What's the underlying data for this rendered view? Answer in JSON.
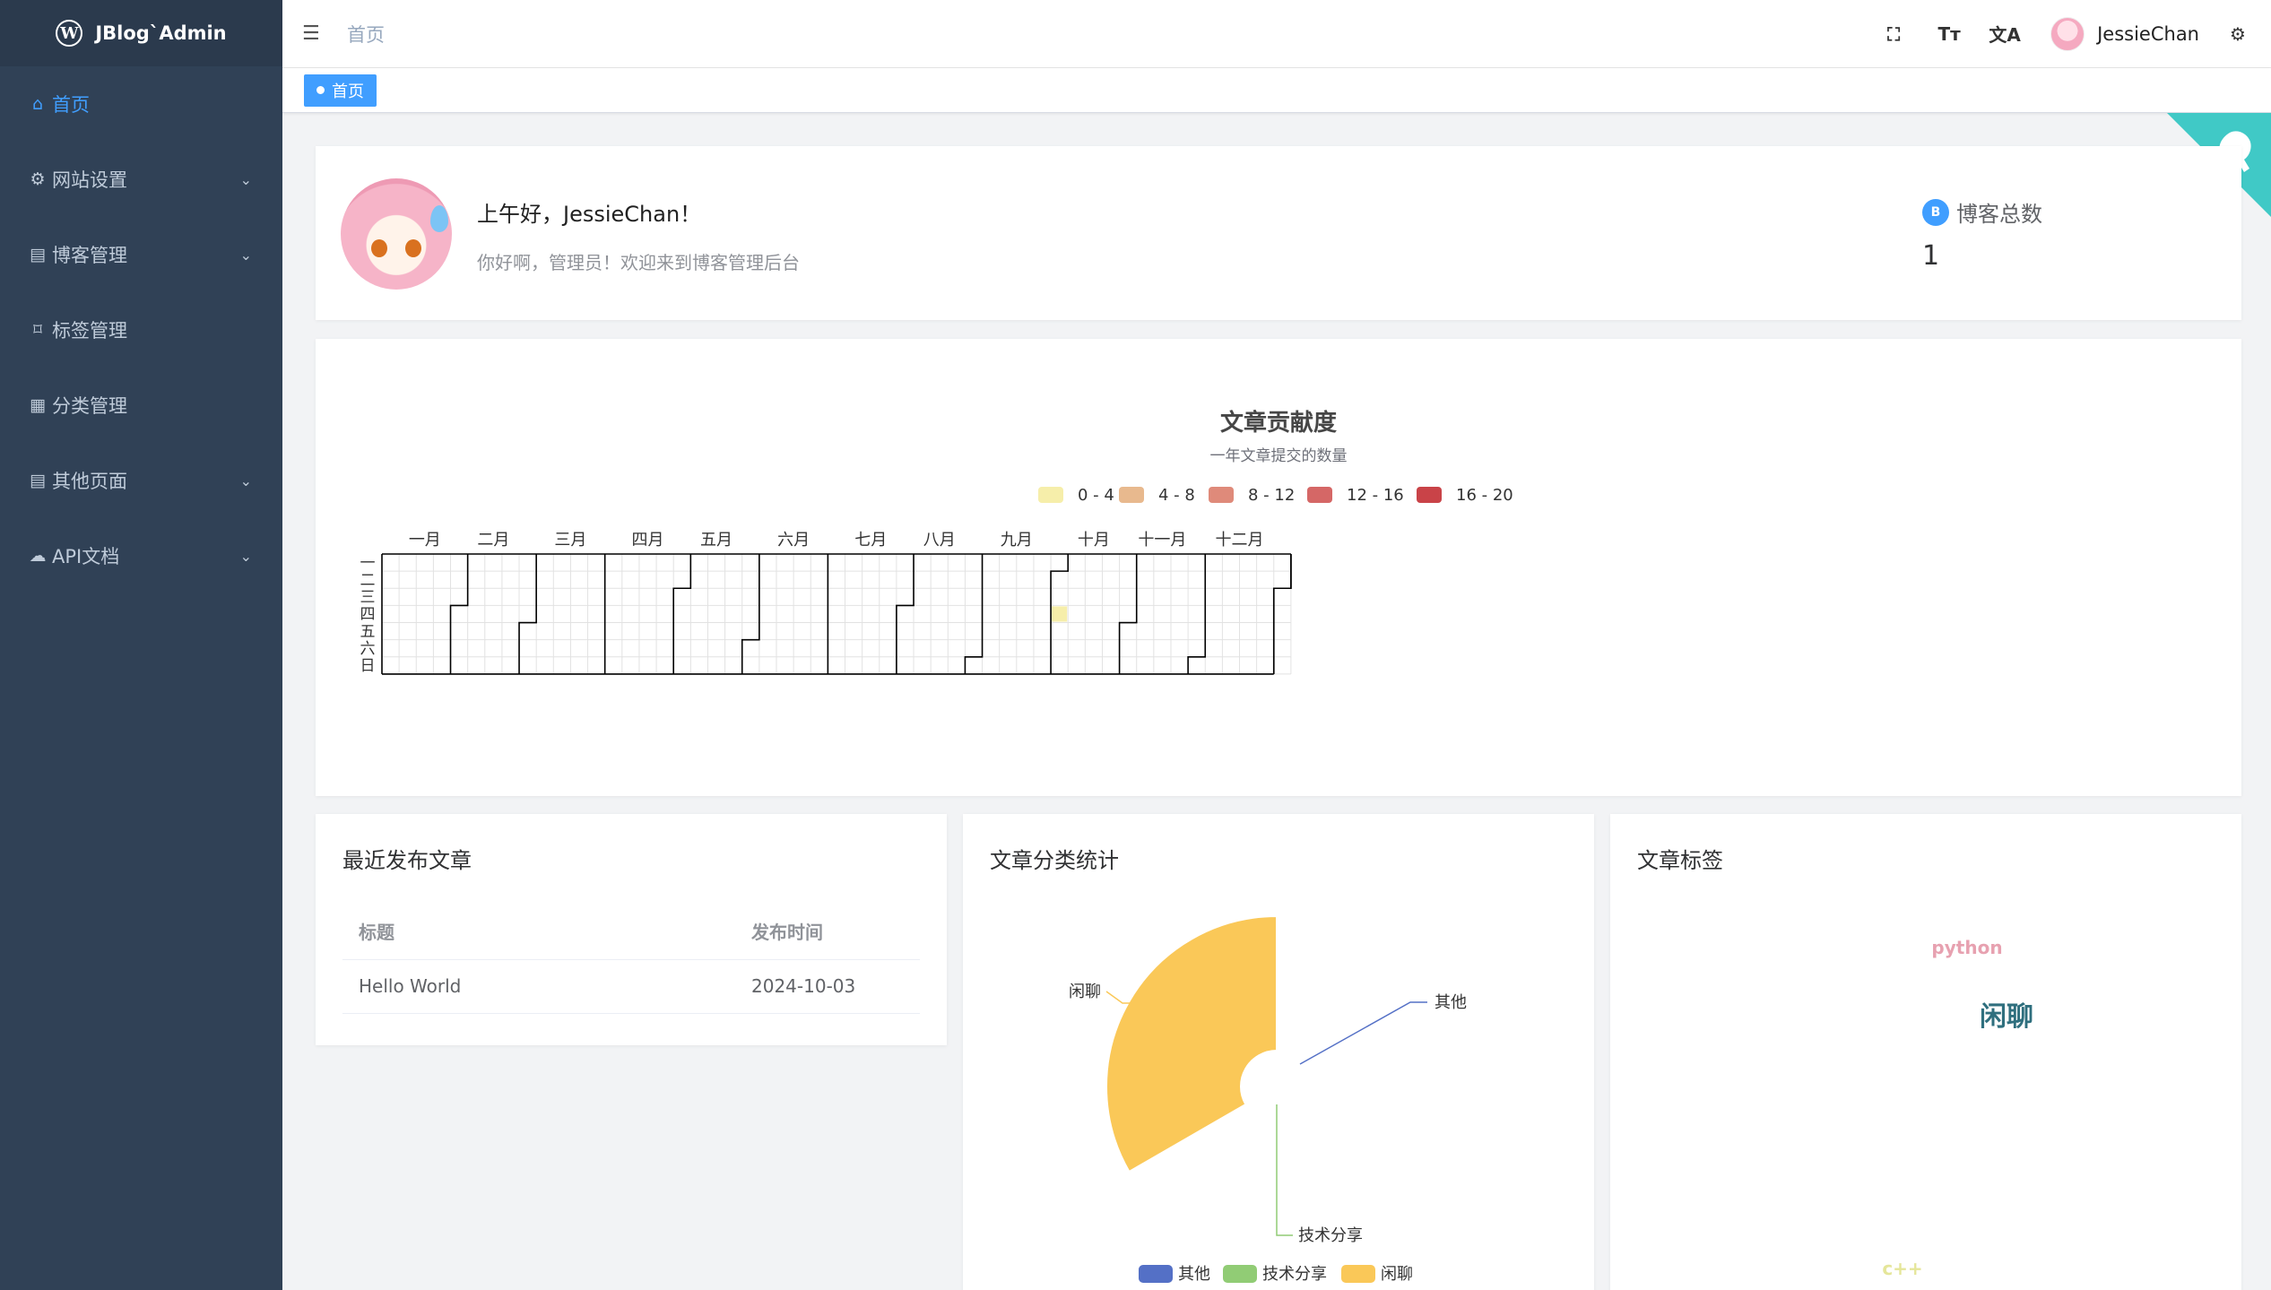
{
  "sidebar": {
    "logo_text": "JBlog`Admin",
    "items": [
      {
        "label": "首页",
        "icon": "home-icon",
        "has_children": false,
        "active": true
      },
      {
        "label": "网站设置",
        "icon": "gear-icon",
        "has_children": true
      },
      {
        "label": "博客管理",
        "icon": "document-icon",
        "has_children": true
      },
      {
        "label": "标签管理",
        "icon": "bookmark-icon",
        "has_children": false
      },
      {
        "label": "分类管理",
        "icon": "grid-icon",
        "has_children": false
      },
      {
        "label": "其他页面",
        "icon": "document-icon",
        "has_children": true
      },
      {
        "label": "API文档",
        "icon": "cloud-icon",
        "has_children": true
      }
    ]
  },
  "header": {
    "breadcrumb": "首页",
    "username": "JessieChan",
    "tools": [
      "fullscreen-icon",
      "font-size-icon",
      "translate-icon"
    ]
  },
  "tags_view": {
    "active_tag": "首页"
  },
  "welcome": {
    "greeting": "上午好，JessieChan！",
    "subtitle": "你好啊，管理员！欢迎来到博客管理后台",
    "stat_label": "博客总数",
    "stat_value": "1"
  },
  "contribution": {
    "title": "文章贡献度",
    "subtitle": "一年文章提交的数量",
    "legend": [
      {
        "label": "0 - 4",
        "color": "#f6eeaa"
      },
      {
        "label": "4 - 8",
        "color": "#e8b98e"
      },
      {
        "label": "8 - 12",
        "color": "#df8a7a"
      },
      {
        "label": "12 - 16",
        "color": "#d56766"
      },
      {
        "label": "16 - 20",
        "color": "#c94348"
      }
    ],
    "months": [
      "一月",
      "二月",
      "三月",
      "四月",
      "五月",
      "六月",
      "七月",
      "八月",
      "九月",
      "十月",
      "十一月",
      "十二月"
    ],
    "weekdays": [
      "一",
      "二",
      "三",
      "四",
      "五",
      "六",
      "日"
    ],
    "marked_date": "2024-10-03",
    "marked_value": 1
  },
  "recent_posts": {
    "title": "最近发布文章",
    "columns": [
      "标题",
      "发布时间"
    ],
    "rows": [
      {
        "title": "Hello World",
        "date": "2024-10-03"
      }
    ]
  },
  "category_stats": {
    "title": "文章分类统计",
    "legend": [
      {
        "name": "其他",
        "color": "#5470c6"
      },
      {
        "name": "技术分享",
        "color": "#91cc75"
      },
      {
        "name": "闲聊",
        "color": "#fac858"
      }
    ]
  },
  "tag_cloud": {
    "title": "文章标签",
    "words": [
      {
        "text": "python",
        "color": "#e7a1b0"
      },
      {
        "text": "闲聊",
        "color": "#2f6f7e"
      },
      {
        "text": "c++",
        "color": "#e5e69a"
      }
    ]
  },
  "chart_data": [
    {
      "type": "heatmap",
      "title": "文章贡献度",
      "subtitle": "一年文章提交的数量",
      "x": [
        "2024-10-03"
      ],
      "values": [
        1
      ],
      "ranges": [
        "0 - 4",
        "4 - 8",
        "8 - 12",
        "12 - 16",
        "16 - 20"
      ]
    },
    {
      "type": "pie",
      "title": "文章分类统计",
      "categories": [
        "其他",
        "技术分享",
        "闲聊"
      ],
      "values": [
        0,
        0,
        1
      ]
    }
  ]
}
